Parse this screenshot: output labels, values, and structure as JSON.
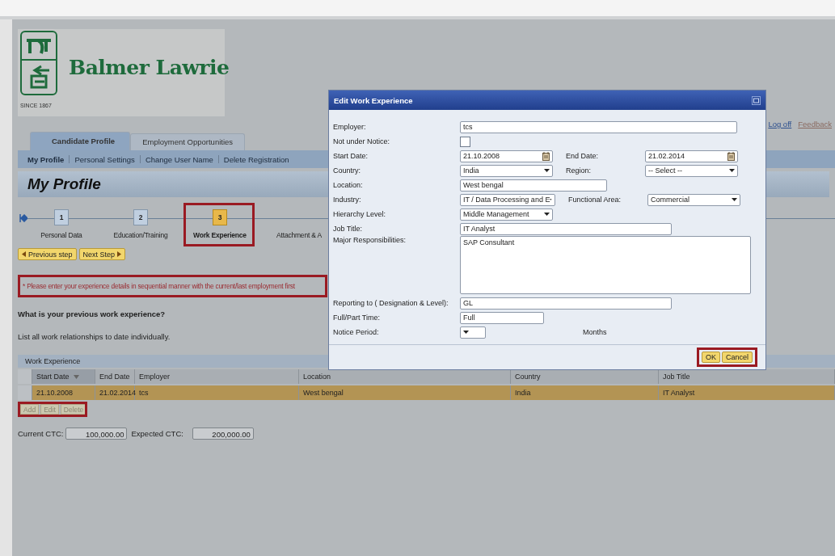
{
  "logo": {
    "brand": "Balmer Lawrie",
    "since": "SINCE 1867"
  },
  "top_links": [
    "Log off",
    "Feedback"
  ],
  "tabs": [
    {
      "label": "Candidate Profile",
      "selected": true
    },
    {
      "label": "Employment Opportunities",
      "selected": false
    }
  ],
  "subnav": [
    {
      "label": "My Profile",
      "selected": true
    },
    {
      "label": "Personal Settings",
      "selected": false
    },
    {
      "label": "Change User Name",
      "selected": false
    },
    {
      "label": "Delete Registration",
      "selected": false
    }
  ],
  "page_title": "My Profile",
  "steps": [
    {
      "number": "1",
      "label": "Personal Data",
      "selected": false
    },
    {
      "number": "2",
      "label": "Education/Training",
      "selected": false
    },
    {
      "number": "3",
      "label": "Work Experience",
      "selected": true,
      "highlighted": true
    },
    {
      "label": "Attachment & A",
      "selected": false
    }
  ],
  "step_buttons": [
    "Previous step",
    "Next Step"
  ],
  "notice": {
    "text": "* Please enter your experience details in sequential manner with the current/last employment first",
    "highlighted": true
  },
  "question": "What is your previous work experience?",
  "instruction": "List all work relationships to date individually.",
  "table": {
    "title": "Work Experience",
    "columns": [
      {
        "label": "Start Date",
        "sorted": true
      },
      {
        "label": "End Date",
        "sorted": false
      },
      {
        "label": "Employer",
        "sorted": false
      },
      {
        "label": "Location",
        "sorted": false
      },
      {
        "label": "Country",
        "sorted": false
      },
      {
        "label": "Job Title",
        "sorted": false
      }
    ],
    "rows": [
      {
        "selected": true,
        "cells": [
          "21.10.2008",
          "21.02.2014",
          "tcs",
          "West bengal",
          "India",
          "IT Analyst"
        ]
      }
    ]
  },
  "table_actions": {
    "highlighted": true,
    "buttons": [
      {
        "label": "Add",
        "disabled": true
      },
      {
        "label": "Edit",
        "disabled": true
      },
      {
        "label": "Delete",
        "disabled": true
      }
    ]
  },
  "ctc": [
    {
      "label": "Current CTC:",
      "value": "100,000.00"
    },
    {
      "label": "Expected CTC:",
      "value": "200,000.00"
    }
  ],
  "dialog": {
    "title": "Edit Work Experience",
    "rows": [
      [
        {
          "label": "Employer:",
          "kind": "text",
          "value": "tcs"
        }
      ],
      [
        {
          "label": "Not under Notice:",
          "kind": "checkbox",
          "checked": false
        }
      ],
      [
        {
          "label": "Start Date:",
          "kind": "date",
          "value": "21.10.2008"
        },
        {
          "label": "End Date:",
          "kind": "date",
          "value": "21.02.2014"
        }
      ],
      [
        {
          "label": "Country:",
          "kind": "select",
          "value": "India"
        },
        {
          "label": "Region:",
          "kind": "select",
          "value": "-- Select --"
        }
      ],
      [
        {
          "label": "Location:",
          "kind": "text",
          "value": "West bengal"
        }
      ],
      [
        {
          "label": "Industry:",
          "kind": "select",
          "value": "IT / Data Processing and E"
        },
        {
          "label": "Functional Area:",
          "kind": "select",
          "value": "Commercial"
        }
      ],
      [
        {
          "label": "Hierarchy Level:",
          "kind": "select",
          "value": "Middle Management"
        }
      ],
      [
        {
          "label": "Job Title:",
          "kind": "text",
          "value": "IT Analyst"
        }
      ],
      [
        {
          "label": "Major Responsibilities:",
          "kind": "textarea",
          "value": "SAP Consultant"
        }
      ],
      [
        {
          "label": "Reporting to ( Designation & Level):",
          "kind": "text",
          "value": "GL"
        }
      ],
      [
        {
          "label": "Full/Part Time:",
          "kind": "text",
          "value": "Full"
        }
      ],
      [
        {
          "label": "Notice Period:",
          "kind": "select",
          "unit": "Months"
        }
      ]
    ],
    "buttons": [
      "OK",
      "Cancel"
    ],
    "buttons_highlighted": true
  }
}
